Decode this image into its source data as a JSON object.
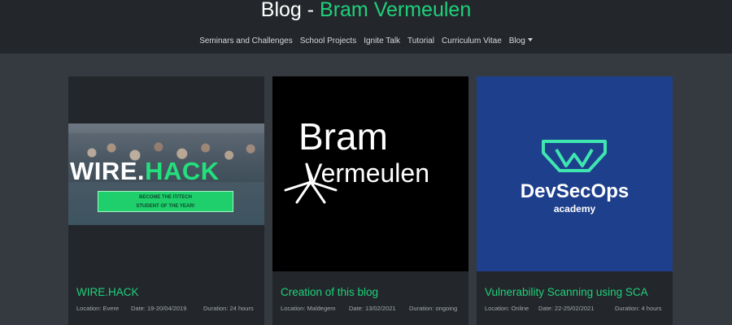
{
  "header": {
    "title_prefix": "Blog - ",
    "title_name": "Bram Vermeulen",
    "nav": [
      "Seminars and Challenges",
      "School Projects",
      "Ignite Talk",
      "Tutorial",
      "Curriculum Vitae",
      "Blog"
    ]
  },
  "cards": [
    {
      "title": "WIRE.HACK",
      "location": "Location: Evere",
      "date": "Date: 19-20/04/2019",
      "duration": "Duration: 24 hours",
      "image": {
        "word_white": "WIRE.",
        "word_green": "HACK",
        "banner_line1": "BECOME THE IT/TECH",
        "banner_line2": "STUDENT OF THE YEAR!"
      }
    },
    {
      "title": "Creation of this blog",
      "location": "Location: Maldegem",
      "date": "Date: 13/02/2021",
      "duration": "Duration: ongoing",
      "image": {
        "line1": "Bram",
        "line2": "Vermeulen"
      }
    },
    {
      "title": "Vulnerability Scanning using SCA",
      "location": "Location: Online",
      "date": "Date: 22-25/02/2021",
      "duration": "Duration: 4 hours",
      "image": {
        "title": "DevSecOps",
        "subtitle": "academy"
      }
    }
  ],
  "colors": {
    "accent": "#1fd17b",
    "background": "#343a40",
    "header_bg": "#23272b",
    "card_bg": "#23272b",
    "devsecops_bg": "#1e3f8b"
  },
  "icons": [
    "caret-down-icon",
    "bram-logo-mark-icon",
    "devsecops-logo-icon"
  ]
}
